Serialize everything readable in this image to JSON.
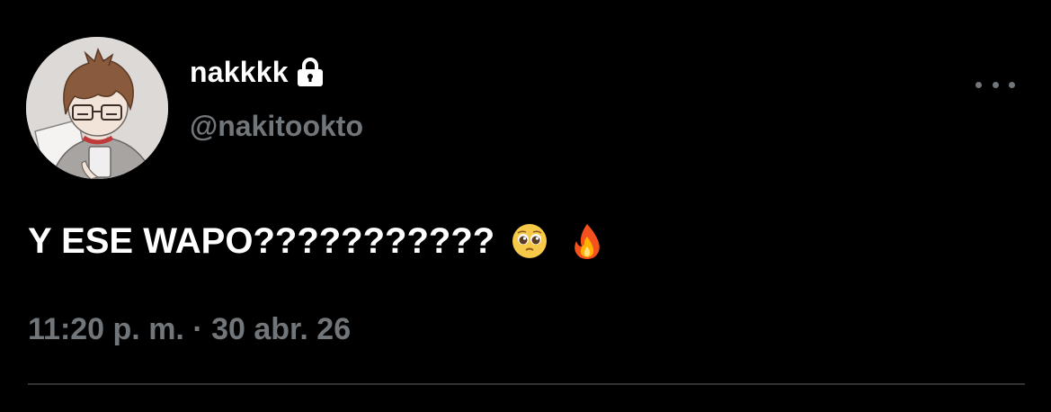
{
  "tweet": {
    "display_name": "nakkkk",
    "handle": "@nakitookto",
    "text": "Y ESE WAPO???????????",
    "emojis": [
      "pleading-face",
      "fire"
    ],
    "time": "11:20 p. m.",
    "separator": "·",
    "date": "30 abr. 26"
  },
  "colors": {
    "background": "#000000",
    "primary_text": "#ffffff",
    "secondary_text": "#71767b",
    "divider": "#2f3336"
  }
}
